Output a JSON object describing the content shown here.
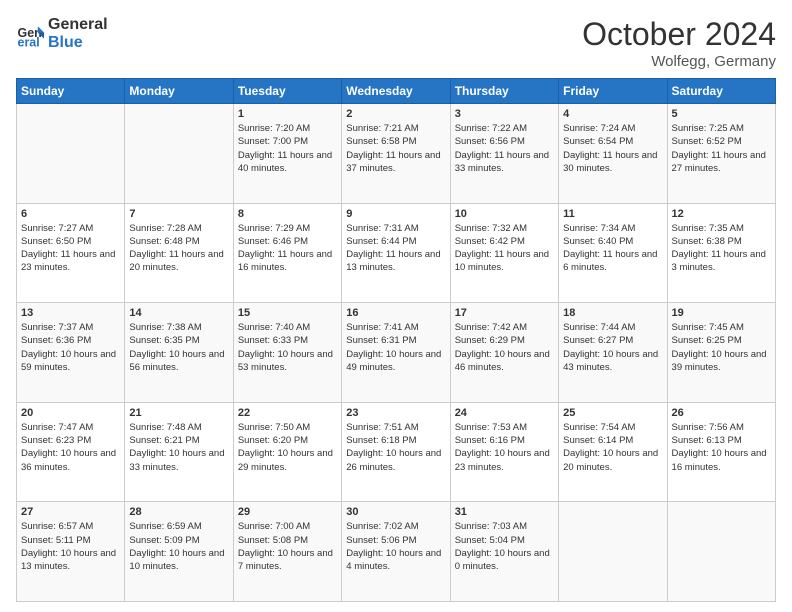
{
  "header": {
    "logo_line1": "General",
    "logo_line2": "Blue",
    "month": "October 2024",
    "location": "Wolfegg, Germany"
  },
  "days_of_week": [
    "Sunday",
    "Monday",
    "Tuesday",
    "Wednesday",
    "Thursday",
    "Friday",
    "Saturday"
  ],
  "weeks": [
    [
      {
        "day": "",
        "info": ""
      },
      {
        "day": "",
        "info": ""
      },
      {
        "day": "1",
        "info": "Sunrise: 7:20 AM\nSunset: 7:00 PM\nDaylight: 11 hours and 40 minutes."
      },
      {
        "day": "2",
        "info": "Sunrise: 7:21 AM\nSunset: 6:58 PM\nDaylight: 11 hours and 37 minutes."
      },
      {
        "day": "3",
        "info": "Sunrise: 7:22 AM\nSunset: 6:56 PM\nDaylight: 11 hours and 33 minutes."
      },
      {
        "day": "4",
        "info": "Sunrise: 7:24 AM\nSunset: 6:54 PM\nDaylight: 11 hours and 30 minutes."
      },
      {
        "day": "5",
        "info": "Sunrise: 7:25 AM\nSunset: 6:52 PM\nDaylight: 11 hours and 27 minutes."
      }
    ],
    [
      {
        "day": "6",
        "info": "Sunrise: 7:27 AM\nSunset: 6:50 PM\nDaylight: 11 hours and 23 minutes."
      },
      {
        "day": "7",
        "info": "Sunrise: 7:28 AM\nSunset: 6:48 PM\nDaylight: 11 hours and 20 minutes."
      },
      {
        "day": "8",
        "info": "Sunrise: 7:29 AM\nSunset: 6:46 PM\nDaylight: 11 hours and 16 minutes."
      },
      {
        "day": "9",
        "info": "Sunrise: 7:31 AM\nSunset: 6:44 PM\nDaylight: 11 hours and 13 minutes."
      },
      {
        "day": "10",
        "info": "Sunrise: 7:32 AM\nSunset: 6:42 PM\nDaylight: 11 hours and 10 minutes."
      },
      {
        "day": "11",
        "info": "Sunrise: 7:34 AM\nSunset: 6:40 PM\nDaylight: 11 hours and 6 minutes."
      },
      {
        "day": "12",
        "info": "Sunrise: 7:35 AM\nSunset: 6:38 PM\nDaylight: 11 hours and 3 minutes."
      }
    ],
    [
      {
        "day": "13",
        "info": "Sunrise: 7:37 AM\nSunset: 6:36 PM\nDaylight: 10 hours and 59 minutes."
      },
      {
        "day": "14",
        "info": "Sunrise: 7:38 AM\nSunset: 6:35 PM\nDaylight: 10 hours and 56 minutes."
      },
      {
        "day": "15",
        "info": "Sunrise: 7:40 AM\nSunset: 6:33 PM\nDaylight: 10 hours and 53 minutes."
      },
      {
        "day": "16",
        "info": "Sunrise: 7:41 AM\nSunset: 6:31 PM\nDaylight: 10 hours and 49 minutes."
      },
      {
        "day": "17",
        "info": "Sunrise: 7:42 AM\nSunset: 6:29 PM\nDaylight: 10 hours and 46 minutes."
      },
      {
        "day": "18",
        "info": "Sunrise: 7:44 AM\nSunset: 6:27 PM\nDaylight: 10 hours and 43 minutes."
      },
      {
        "day": "19",
        "info": "Sunrise: 7:45 AM\nSunset: 6:25 PM\nDaylight: 10 hours and 39 minutes."
      }
    ],
    [
      {
        "day": "20",
        "info": "Sunrise: 7:47 AM\nSunset: 6:23 PM\nDaylight: 10 hours and 36 minutes."
      },
      {
        "day": "21",
        "info": "Sunrise: 7:48 AM\nSunset: 6:21 PM\nDaylight: 10 hours and 33 minutes."
      },
      {
        "day": "22",
        "info": "Sunrise: 7:50 AM\nSunset: 6:20 PM\nDaylight: 10 hours and 29 minutes."
      },
      {
        "day": "23",
        "info": "Sunrise: 7:51 AM\nSunset: 6:18 PM\nDaylight: 10 hours and 26 minutes."
      },
      {
        "day": "24",
        "info": "Sunrise: 7:53 AM\nSunset: 6:16 PM\nDaylight: 10 hours and 23 minutes."
      },
      {
        "day": "25",
        "info": "Sunrise: 7:54 AM\nSunset: 6:14 PM\nDaylight: 10 hours and 20 minutes."
      },
      {
        "day": "26",
        "info": "Sunrise: 7:56 AM\nSunset: 6:13 PM\nDaylight: 10 hours and 16 minutes."
      }
    ],
    [
      {
        "day": "27",
        "info": "Sunrise: 6:57 AM\nSunset: 5:11 PM\nDaylight: 10 hours and 13 minutes."
      },
      {
        "day": "28",
        "info": "Sunrise: 6:59 AM\nSunset: 5:09 PM\nDaylight: 10 hours and 10 minutes."
      },
      {
        "day": "29",
        "info": "Sunrise: 7:00 AM\nSunset: 5:08 PM\nDaylight: 10 hours and 7 minutes."
      },
      {
        "day": "30",
        "info": "Sunrise: 7:02 AM\nSunset: 5:06 PM\nDaylight: 10 hours and 4 minutes."
      },
      {
        "day": "31",
        "info": "Sunrise: 7:03 AM\nSunset: 5:04 PM\nDaylight: 10 hours and 0 minutes."
      },
      {
        "day": "",
        "info": ""
      },
      {
        "day": "",
        "info": ""
      }
    ]
  ]
}
